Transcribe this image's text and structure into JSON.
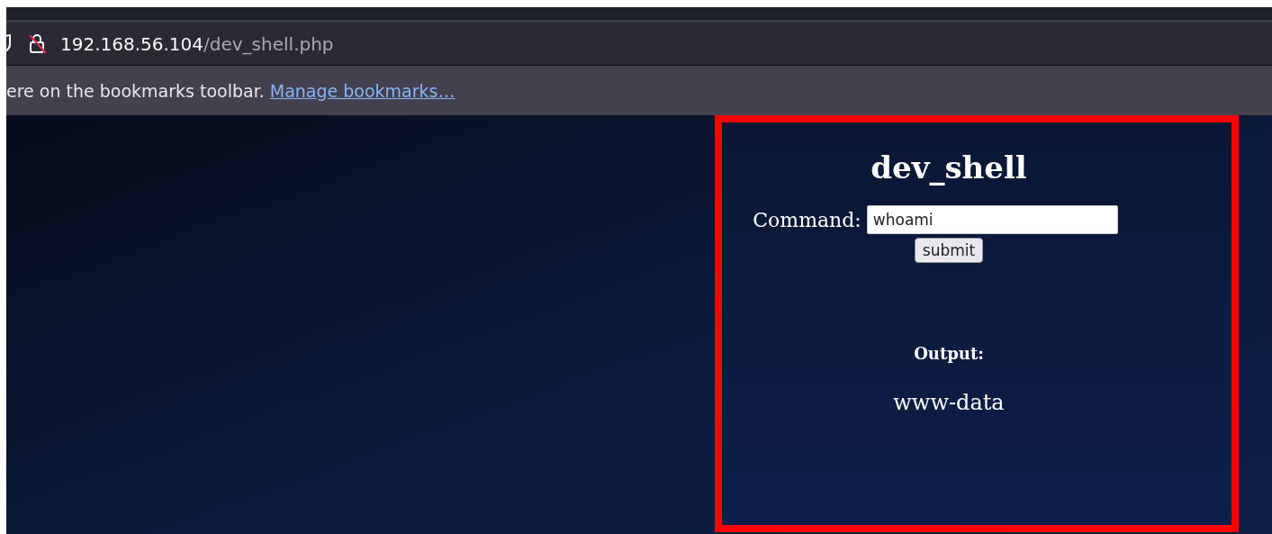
{
  "address_bar": {
    "host": "192.168.56.104",
    "path": "/dev_shell.php"
  },
  "bookmarks_bar": {
    "message": "ere on the bookmarks toolbar.",
    "link": "Manage bookmarks…"
  },
  "page": {
    "title": "dev_shell",
    "command_label": "Command:",
    "command_value": "whoami",
    "submit": "submit",
    "output_label": "Output:",
    "output": "www-data"
  }
}
